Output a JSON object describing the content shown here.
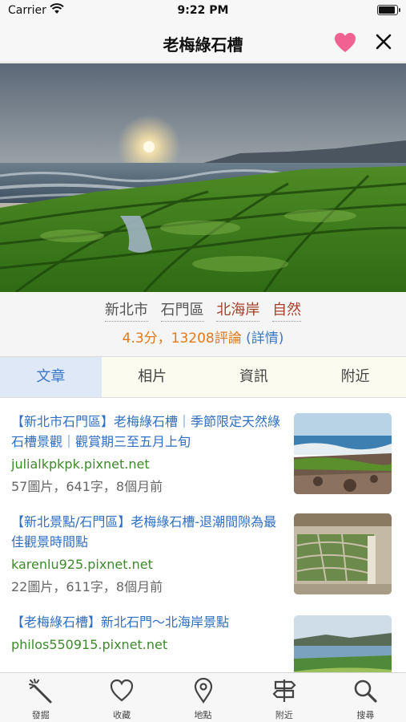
{
  "status_bar": {
    "carrier": "Carrier",
    "time": "9:22 PM"
  },
  "nav": {
    "title": "老梅綠石槽",
    "favorite_icon": "heart-icon",
    "close_icon": "close-icon",
    "favorite_color": "#f06292"
  },
  "meta": {
    "tags": [
      "新北市",
      "石門區",
      "北海岸",
      "自然"
    ],
    "rating_text": "4.3分，13208評論",
    "rating_detail": "(詳情)"
  },
  "tabs": [
    {
      "label": "文章",
      "active": true
    },
    {
      "label": "相片",
      "active": false
    },
    {
      "label": "資訊",
      "active": false
    },
    {
      "label": "附近",
      "active": false
    }
  ],
  "articles": [
    {
      "title": "【新北市石門區】老梅綠石槽｜季節限定天然綠石槽景觀｜觀賞期三至五月上旬",
      "source": "julialkpkpk.pixnet.net",
      "info": "57圖片，641字，8個月前"
    },
    {
      "title": "【新北景點/石門區】老梅綠石槽-退潮間隙為最佳觀景時間點",
      "source": "karenlu925.pixnet.net",
      "info": "22圖片，611字，8個月前"
    },
    {
      "title": "【老梅綠石槽】新北石門～北海岸景點",
      "source": "philos550915.pixnet.net",
      "info": ""
    }
  ],
  "tabbar": [
    {
      "label": "發掘",
      "icon": "magic-wand-icon"
    },
    {
      "label": "收藏",
      "icon": "heart-outline-icon"
    },
    {
      "label": "地點",
      "icon": "location-pin-icon"
    },
    {
      "label": "附近",
      "icon": "signpost-icon"
    },
    {
      "label": "搜尋",
      "icon": "search-icon"
    }
  ],
  "colors": {
    "link_blue": "#2f6fc3",
    "source_green": "#3c8a2a",
    "rating_orange": "#e07a1f",
    "tag_red": "#a5402a",
    "active_tab_bg": "#dfe8f6"
  }
}
